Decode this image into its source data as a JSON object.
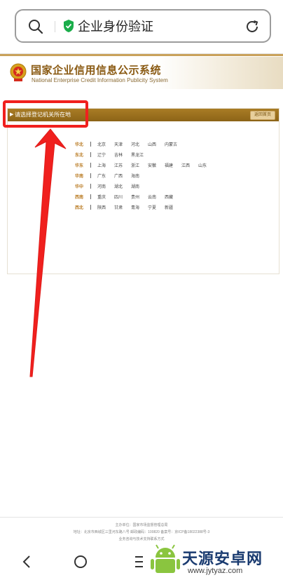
{
  "browser": {
    "url_text": "企业身份验证"
  },
  "site": {
    "title": "国家企业信用信息公示系统",
    "subtitle": "National Enterprise Credit Information Publicity System"
  },
  "panel": {
    "title": "请选择登记机关所在地",
    "back_home": "返回首页"
  },
  "regions": [
    {
      "name": "华北",
      "provinces": [
        "北京",
        "天津",
        "河北",
        "山西",
        "内蒙古"
      ]
    },
    {
      "name": "东北",
      "provinces": [
        "辽宁",
        "吉林",
        "黑龙江"
      ]
    },
    {
      "name": "华东",
      "provinces": [
        "上海",
        "江苏",
        "浙江",
        "安徽",
        "福建",
        "江西",
        "山东"
      ]
    },
    {
      "name": "华南",
      "provinces": [
        "广东",
        "广西",
        "海南"
      ]
    },
    {
      "name": "华中",
      "provinces": [
        "河南",
        "湖北",
        "湖南"
      ]
    },
    {
      "name": "西南",
      "provinces": [
        "重庆",
        "四川",
        "贵州",
        "云南",
        "西藏"
      ]
    },
    {
      "name": "西北",
      "provinces": [
        "陕西",
        "甘肃",
        "青海",
        "宁夏",
        "新疆"
      ]
    }
  ],
  "footer": {
    "line1": "主办单位：国家市场监督管理总局",
    "line2": "地址：北京市西城区三里河东路八号  邮政编码：100820  备案号：京ICP备18022388号-3",
    "line3": "业务咨询与技术支持联系方式"
  },
  "watermark": {
    "name": "天源安卓网",
    "url": "www.jytyaz.com"
  },
  "colors": {
    "accent_gold": "#a97c25",
    "highlight_red": "#f0201e",
    "region_label": "#b8781e"
  }
}
